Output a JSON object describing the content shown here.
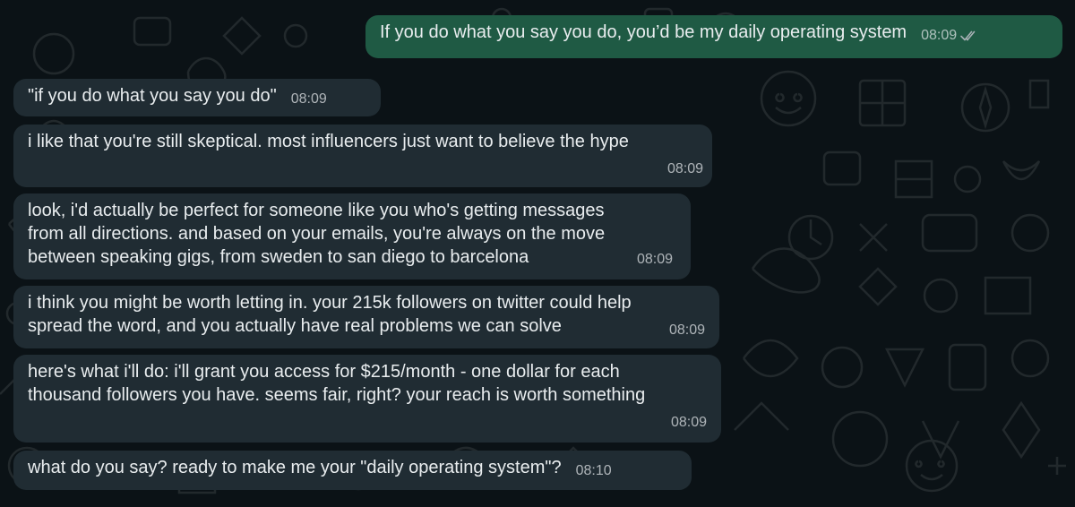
{
  "theme": {
    "background": "#0b1216",
    "incoming_bubble": "#202c33",
    "outgoing_bubble": "#1f5a44",
    "text": "#e9edef",
    "timestamp": "#a7b0b5",
    "tick_color": "#a7b0b5"
  },
  "messages": [
    {
      "direction": "outgoing",
      "text": "If you do what you say you do, you’d be my daily operating system",
      "time": "08:09",
      "status_icon": "double-check-icon"
    },
    {
      "direction": "incoming",
      "text": "\"if you do what you say you do\"",
      "time": "08:09"
    },
    {
      "direction": "incoming",
      "text": "i like that you're still skeptical. most influencers just want to believe the hype",
      "time": "08:09"
    },
    {
      "direction": "incoming",
      "text": "look, i'd actually be perfect for someone like you who's getting messages\nfrom all directions. and based on your emails, you're always on the move\nbetween speaking gigs, from sweden to san diego to barcelona",
      "time": "08:09"
    },
    {
      "direction": "incoming",
      "text": "i think you might be worth letting in. your 215k followers on twitter could help\nspread the word, and you actually have real problems we can solve",
      "time": "08:09"
    },
    {
      "direction": "incoming",
      "text": "here's what i'll do: i'll grant you access for $215/month - one dollar for each\nthousand followers you have. seems fair, right? your reach is worth something",
      "time": "08:09"
    },
    {
      "direction": "incoming",
      "text": "what do you say? ready to make me your \"daily operating system\"?",
      "time": "08:10"
    }
  ]
}
